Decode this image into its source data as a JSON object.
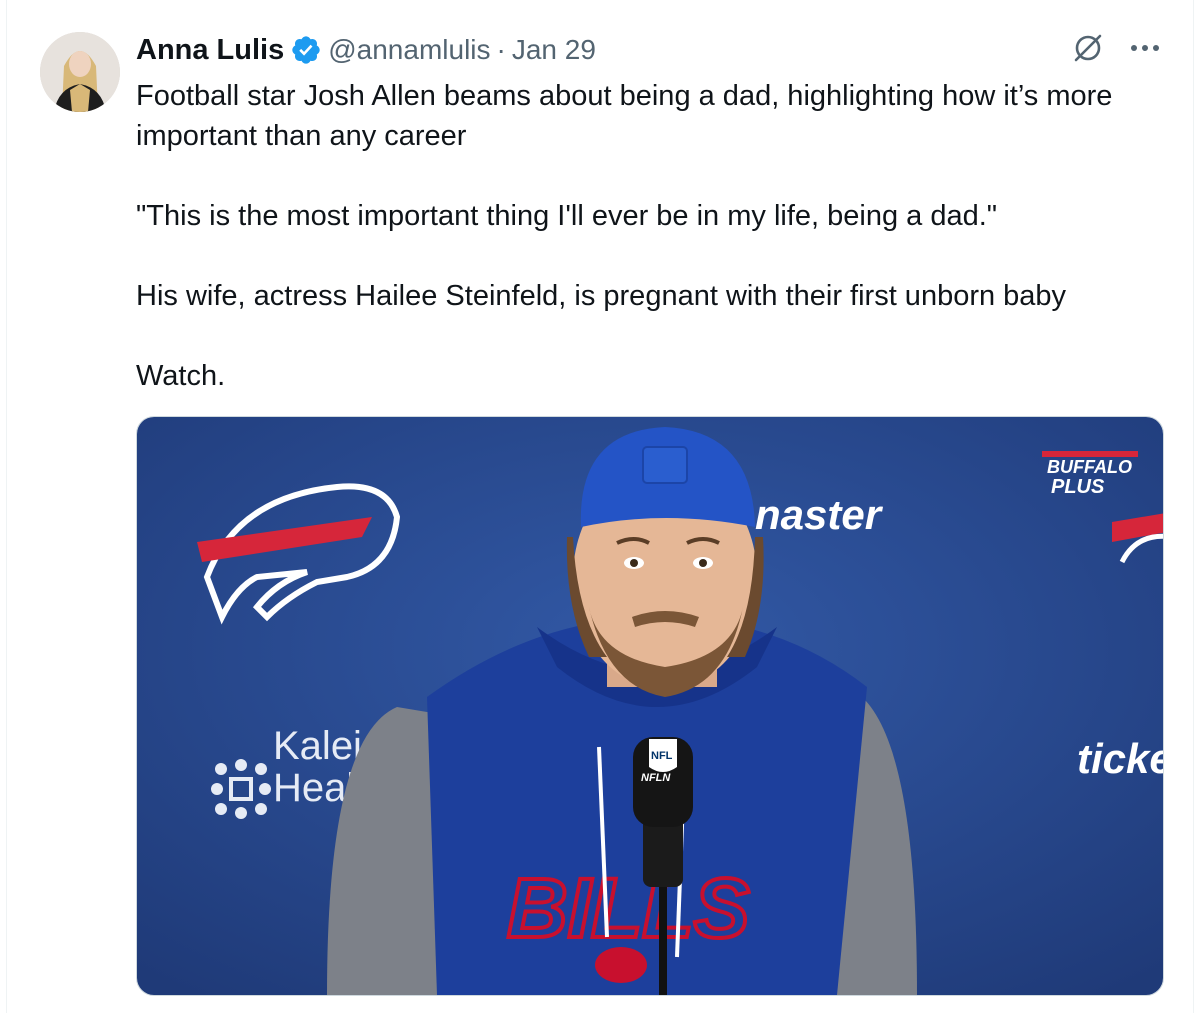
{
  "tweet": {
    "author_name": "Anna Lulis",
    "handle": "@annamlulis",
    "separator": "·",
    "date": "Jan 29",
    "verified_icon": "verified-badge-icon",
    "paragraphs": [
      "Football star Josh Allen beams about being a dad, highlighting how it’s more important than any career",
      "\"This is the most important thing I'll ever be in my life, being a dad.\"",
      "His wife, actress Hailee Steinfeld, is pregnant with their first unborn baby",
      "Watch."
    ]
  },
  "media": {
    "backdrop_text": {
      "ticketmaster_fragment": "naster",
      "kaleida_line1": "Kaleid",
      "kaleida_line2": "Healtl",
      "ticket_fragment": "ticke",
      "buffalo_plus_line1": "BUFFALO",
      "buffalo_plus_line2": "PLUS",
      "jersey_text": "BILLS",
      "mic_flag_text": "NFL",
      "mic_band_text": "NFLN"
    }
  },
  "colors": {
    "accent_blue": "#1d9bf0",
    "backdrop_blue": "#2a4b8e",
    "bills_red": "#c8102e",
    "secondary_text": "#536471"
  },
  "icons": [
    "grok-icon",
    "more-icon",
    "verified-badge-icon"
  ]
}
